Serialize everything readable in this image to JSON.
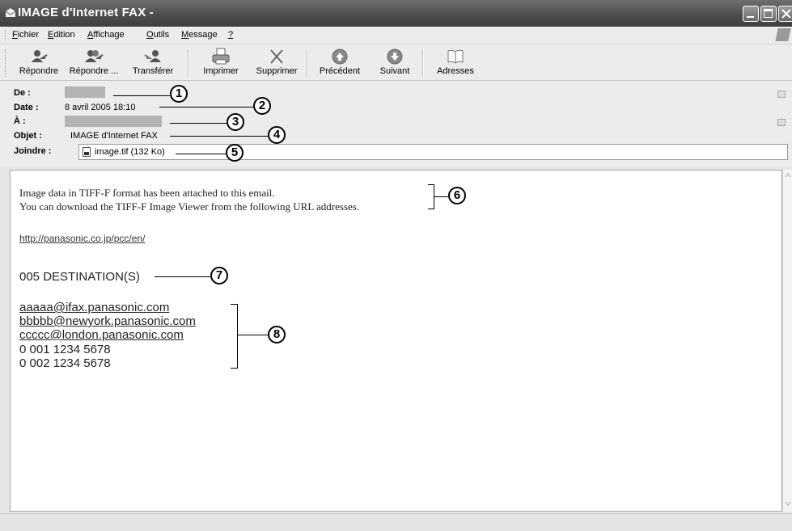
{
  "window": {
    "title": "IMAGE d'Internet FAX -"
  },
  "menubar": {
    "items": [
      {
        "accel": "F",
        "rest": "ichier"
      },
      {
        "accel": "E",
        "rest": "dition"
      },
      {
        "accel": "A",
        "rest": "ffichage"
      },
      {
        "accel": "O",
        "rest": "utils"
      },
      {
        "accel": "M",
        "rest": "essage"
      },
      {
        "accel": "?",
        "rest": ""
      }
    ]
  },
  "toolbar": {
    "reply": "Répondre",
    "reply_all": "Répondre ...",
    "forward": "Transférer",
    "print": "Imprimer",
    "delete": "Supprimer",
    "previous": "Précédent",
    "next": "Suivant",
    "addresses": "Adresses"
  },
  "header": {
    "from_label": "De :",
    "date_label": "Date :",
    "date_value": "8 avril 2005 18:10",
    "to_label": "À :",
    "subject_label": "Objet :",
    "subject_value": "IMAGE d'Internet FAX",
    "attach_label": "Joindre :",
    "attachment": "image.tif (132 Ko)"
  },
  "body": {
    "line1": "Image data in TIFF-F format has been attached to this email.",
    "line2": "You can download the TIFF-F Image Viewer from the following URL addresses.",
    "url": "http://panasonic.co.jp/pcc/en/",
    "destinations": "005 DESTINATION(S)",
    "recipients": [
      "aaaaa@ifax.panasonic.com",
      "bbbbb@newyork.panasonic.com",
      "ccccc@london.panasonic.com",
      "0 001 1234 5678",
      "0 002 1234 5678"
    ]
  },
  "callouts": [
    "1",
    "2",
    "3",
    "4",
    "5",
    "6",
    "7",
    "8"
  ],
  "colors": {
    "titlebar": "#4d4d4d",
    "chrome": "#ececec",
    "mask": "#b3b3b3"
  }
}
